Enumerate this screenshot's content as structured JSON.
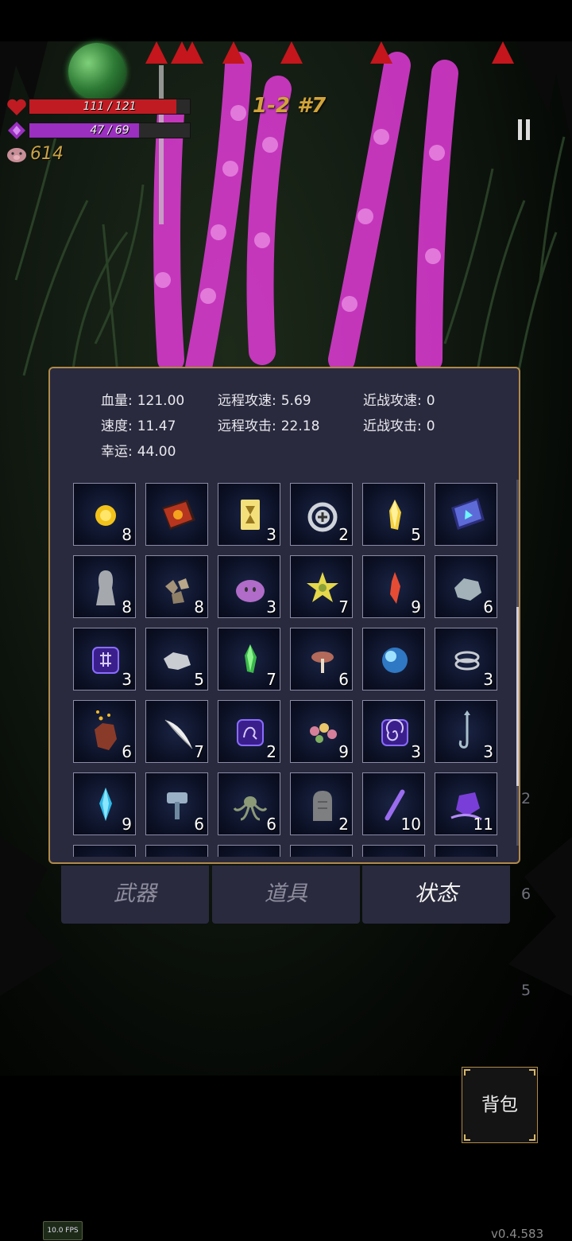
{
  "hud": {
    "hp_text": "111 / 121",
    "hp_fraction": 0.917,
    "mp_text": "47 / 69",
    "mp_fraction": 0.681,
    "coins": "614",
    "wave": "1-2 #7"
  },
  "side_counts": [
    "2",
    "6",
    "5"
  ],
  "stats": {
    "rows": [
      {
        "k": "血量:",
        "v": "121.00"
      },
      {
        "k": "远程攻速:",
        "v": "5.69"
      },
      {
        "k": "近战攻速:",
        "v": "0"
      },
      {
        "k": "速度:",
        "v": "11.47"
      },
      {
        "k": "远程攻击:",
        "v": "22.18"
      },
      {
        "k": "近战攻击:",
        "v": "0"
      },
      {
        "k": "幸运:",
        "v": "44.00"
      }
    ]
  },
  "items": [
    {
      "icon": "gold-coin-icon",
      "count": "8"
    },
    {
      "icon": "red-tome-icon",
      "count": ""
    },
    {
      "icon": "yellow-rune-card-icon",
      "count": "3"
    },
    {
      "icon": "silver-cross-ring-icon",
      "count": "2"
    },
    {
      "icon": "yellow-crystal-icon",
      "count": "5"
    },
    {
      "icon": "blue-spellbook-icon",
      "count": ""
    },
    {
      "icon": "grey-ghost-figure-icon",
      "count": "8"
    },
    {
      "icon": "rock-pile-icon",
      "count": "8"
    },
    {
      "icon": "purple-slime-icon",
      "count": "3"
    },
    {
      "icon": "yellow-star-fruit-icon",
      "count": "7"
    },
    {
      "icon": "red-crystal-icon",
      "count": "9"
    },
    {
      "icon": "grey-stone-icon",
      "count": "6"
    },
    {
      "icon": "purple-glyph-cube-icon",
      "count": "3"
    },
    {
      "icon": "silver-ore-icon",
      "count": "5"
    },
    {
      "icon": "green-crystal-icon",
      "count": "7"
    },
    {
      "icon": "mushroom-icon",
      "count": "6"
    },
    {
      "icon": "blue-orb-icon",
      "count": ""
    },
    {
      "icon": "silver-rings-icon",
      "count": "3"
    },
    {
      "icon": "lava-heart-icon",
      "count": "6"
    },
    {
      "icon": "white-feather-icon",
      "count": "7"
    },
    {
      "icon": "purple-hook-cube-icon",
      "count": "2"
    },
    {
      "icon": "flower-wreath-icon",
      "count": "9"
    },
    {
      "icon": "purple-spiral-cube-icon",
      "count": "3"
    },
    {
      "icon": "fish-hook-icon",
      "count": "3"
    },
    {
      "icon": "blue-shard-icon",
      "count": "9"
    },
    {
      "icon": "steel-hammer-icon",
      "count": "6"
    },
    {
      "icon": "tentacle-creature-icon",
      "count": "6"
    },
    {
      "icon": "gravestone-icon",
      "count": "2"
    },
    {
      "icon": "purple-wand-icon",
      "count": "10"
    },
    {
      "icon": "purple-snail-icon",
      "count": "11"
    }
  ],
  "tabs": [
    {
      "label": "武器",
      "active": false
    },
    {
      "label": "道具",
      "active": false
    },
    {
      "label": "状态",
      "active": true
    }
  ],
  "bag_button": "背包",
  "fps": "10.0 FPS",
  "version": "v0.4.583",
  "colors": {
    "hp": "#c01b22",
    "mp": "#9b2fc0",
    "panel": "#2a2a3e",
    "border": "#b08a4a",
    "magenta": "#e23bd8"
  }
}
